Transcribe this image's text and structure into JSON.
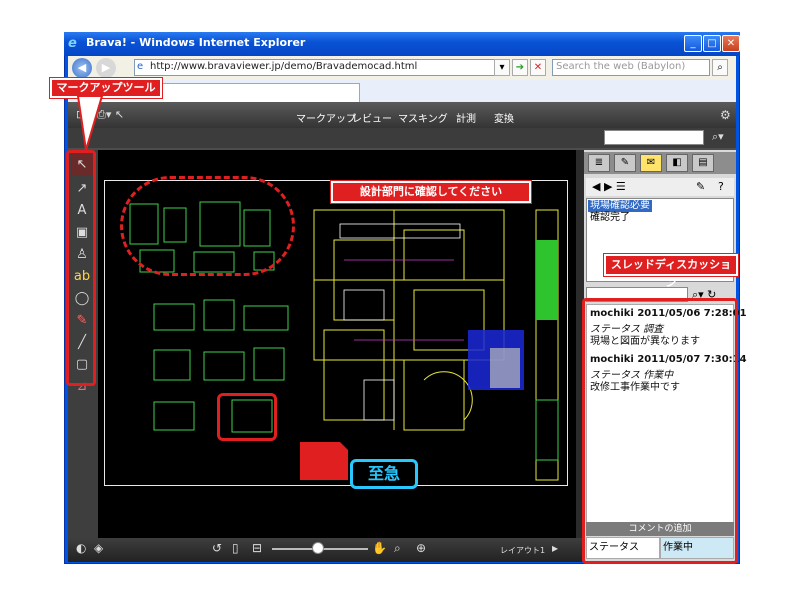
{
  "browser": {
    "title": "Brava! - Windows Internet Explorer",
    "address": "http://www.bravaviewer.jp/demo/Bravademocad.html",
    "search_placeholder": "Search the web (Babylon)"
  },
  "app": {
    "menus": [
      "マークアップ",
      "レビュー",
      "マスキング",
      "計測",
      "変換"
    ],
    "layout_label": "レイアウト1"
  },
  "annotations": {
    "markup_tools": "マークアップツール",
    "check_design": "設計部門に確認してください",
    "thread_discussion": "スレッドディスカッション",
    "urgent": "至急"
  },
  "statuses": [
    "現場確認必要",
    "確認完了"
  ],
  "comments": [
    {
      "header": "mochiki 2011/05/06 7:28:01",
      "status": "ステータス 調査",
      "text": "現場と図面が異なります"
    },
    {
      "header": "mochiki 2011/05/07 7:30:14",
      "status": "ステータス 作業中",
      "text": "改修工事作業中です"
    }
  ],
  "comment_add_label": "コメントの追加",
  "status_field": {
    "label": "ステータス",
    "value": "作業中"
  },
  "colors": {
    "callout": "#e02020",
    "urgent": "#28c8ff",
    "selection": "#316ac5"
  }
}
